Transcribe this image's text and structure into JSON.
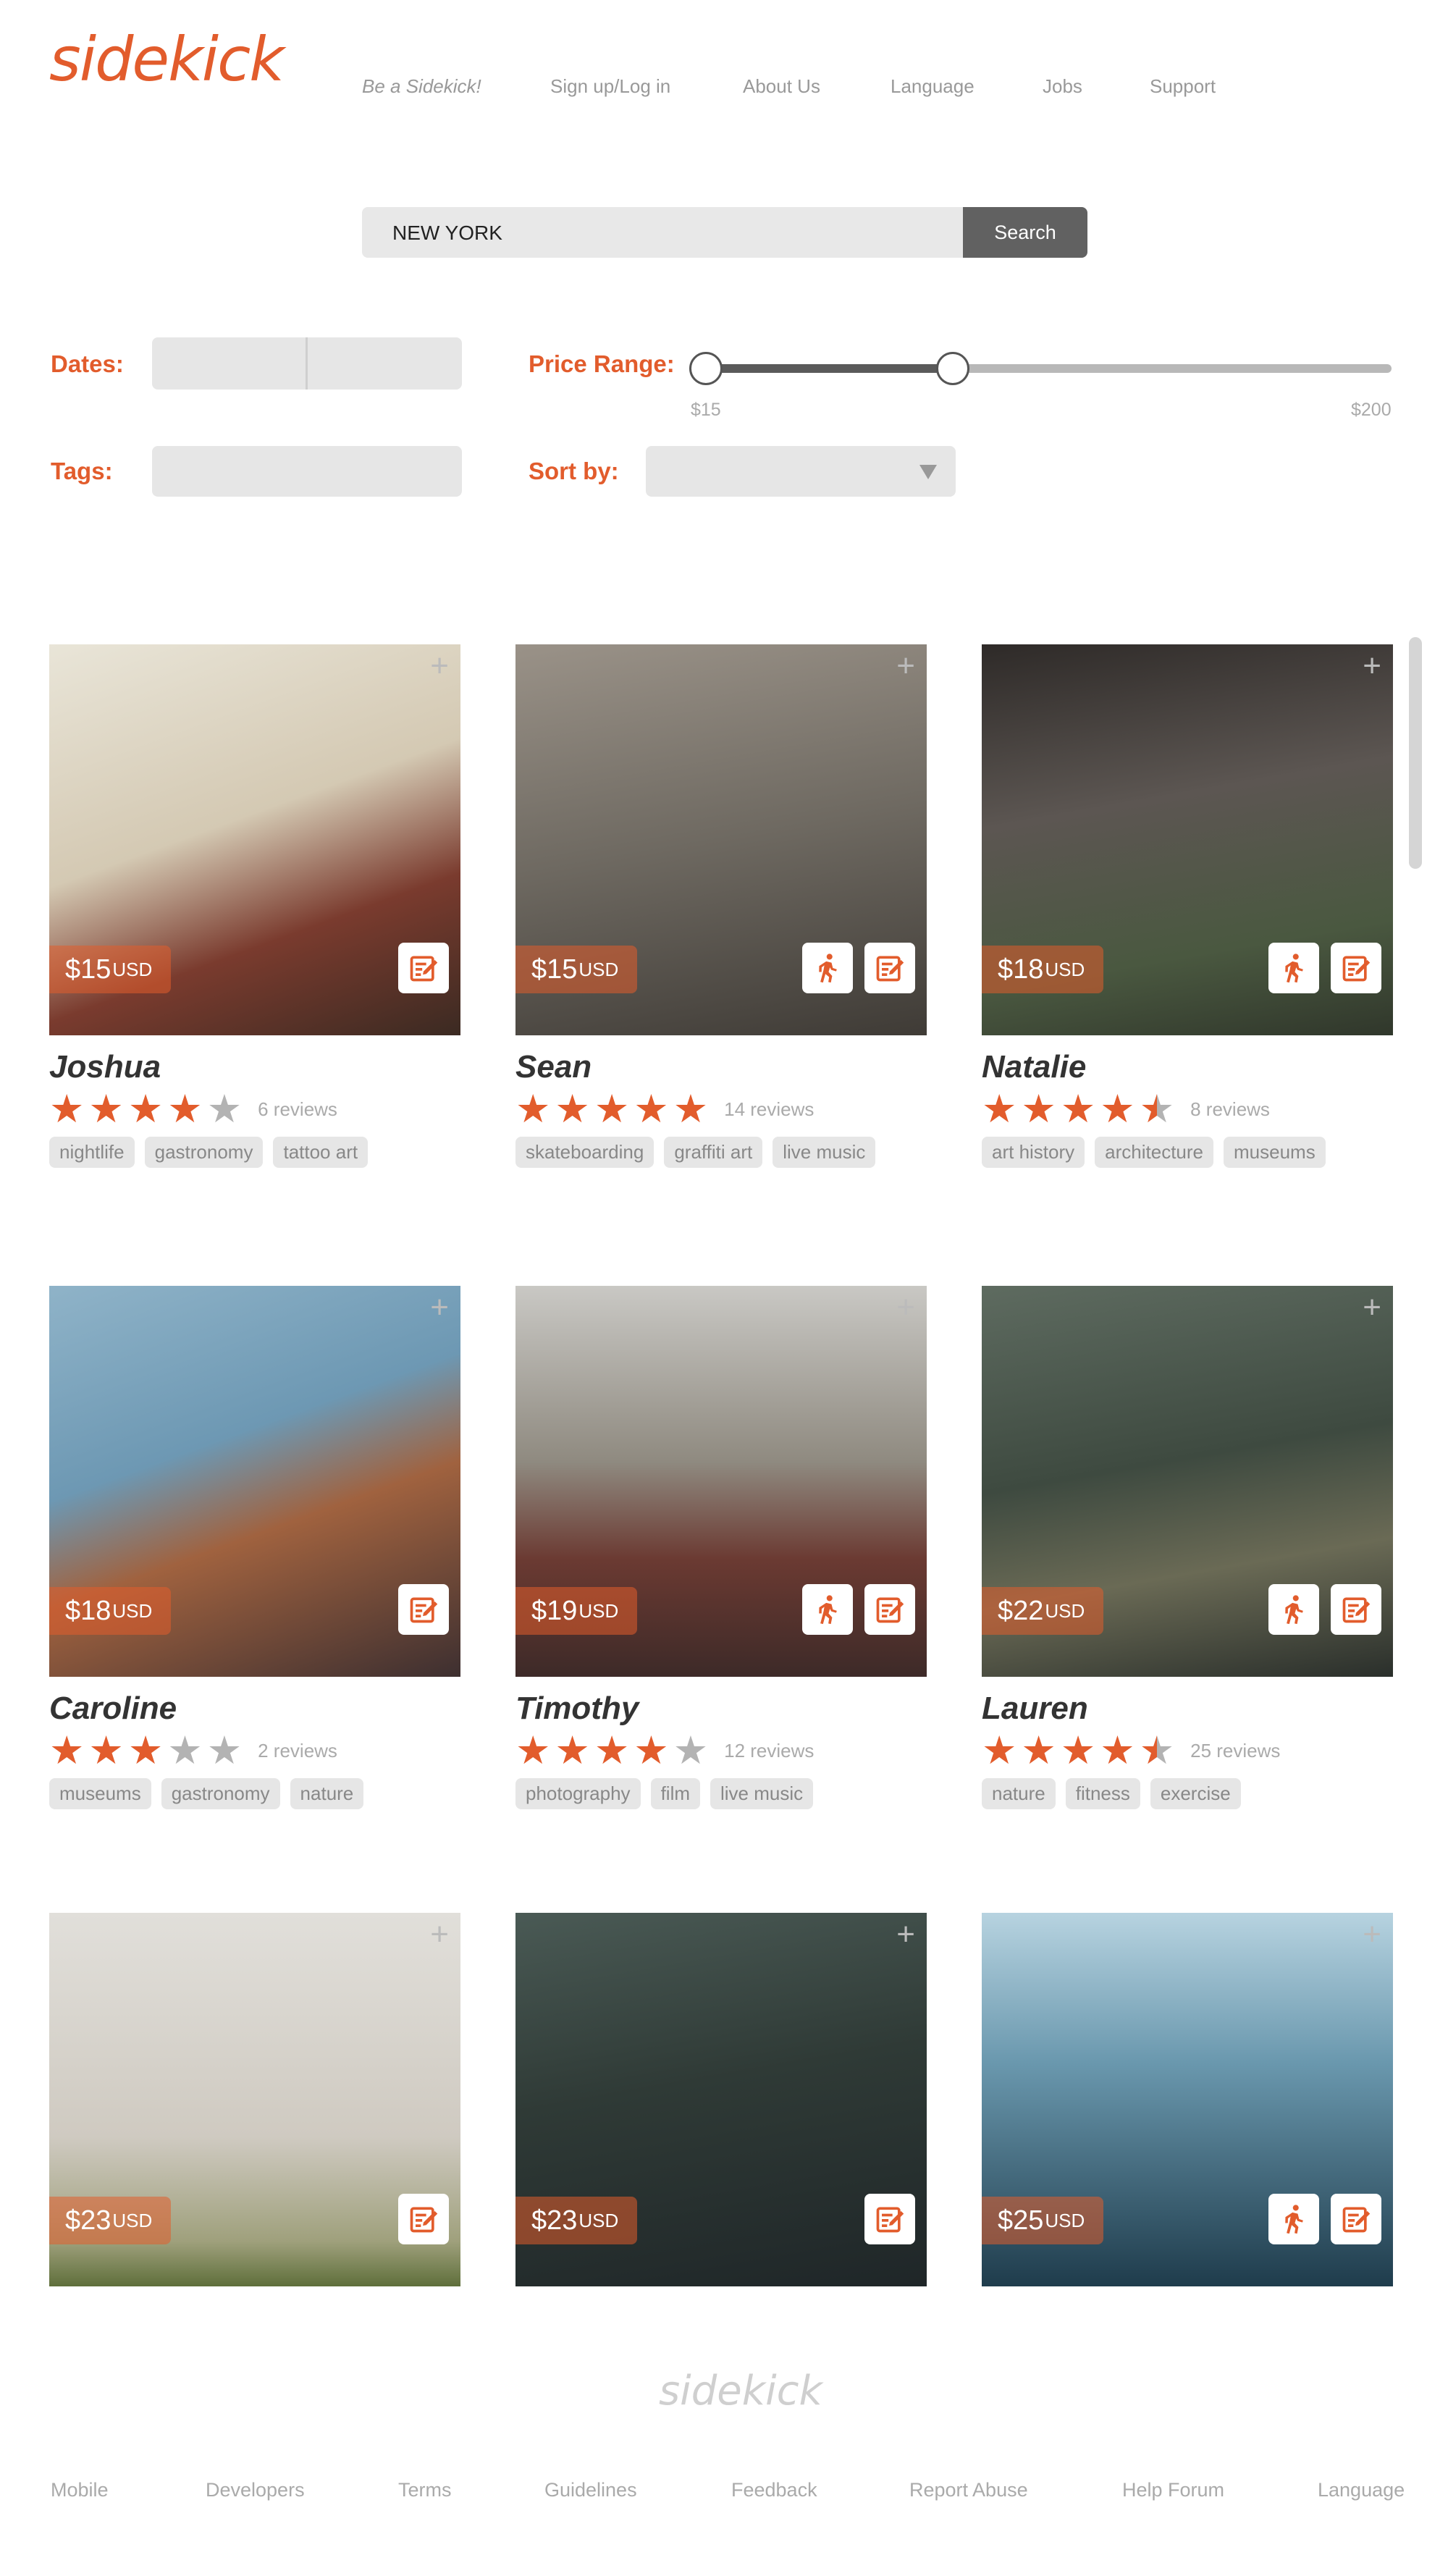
{
  "brand": {
    "logo": "sidekick",
    "accent": "#e25c2c"
  },
  "nav": [
    "Be a Sidekick!",
    "Sign up/Log in",
    "About Us",
    "Language",
    "Jobs",
    "Support"
  ],
  "search": {
    "value": "NEW YORK",
    "button": "Search"
  },
  "filters": {
    "dates_label": "Dates:",
    "price_label": "Price Range:",
    "price_min": "$15",
    "price_max": "$200",
    "price_selected_fraction": 0.36,
    "tags_label": "Tags:",
    "sort_label": "Sort by:"
  },
  "cards": [
    {
      "name": "Joshua",
      "price": "$15",
      "currency": "USD",
      "rating": 4,
      "reviews": "6 reviews",
      "tags": [
        "nightlife",
        "gastronomy",
        "tattoo art"
      ],
      "hike": false
    },
    {
      "name": "Sean",
      "price": "$15",
      "currency": "USD",
      "rating": 5,
      "reviews": "14 reviews",
      "tags": [
        "skateboarding",
        "graffiti art",
        "live music"
      ],
      "hike": true
    },
    {
      "name": "Natalie",
      "price": "$18",
      "currency": "USD",
      "rating": 4.5,
      "reviews": "8 reviews",
      "tags": [
        "art history",
        "architecture",
        "museums"
      ],
      "hike": true
    },
    {
      "name": "Caroline",
      "price": "$18",
      "currency": "USD",
      "rating": 3,
      "reviews": "2 reviews",
      "tags": [
        "museums",
        "gastronomy",
        "nature"
      ],
      "hike": false
    },
    {
      "name": "Timothy",
      "price": "$19",
      "currency": "USD",
      "rating": 4,
      "reviews": "12 reviews",
      "tags": [
        "photography",
        "film",
        "live music"
      ],
      "hike": true
    },
    {
      "name": "Lauren",
      "price": "$22",
      "currency": "USD",
      "rating": 4.5,
      "reviews": "25 reviews",
      "tags": [
        "nature",
        "fitness",
        "exercise"
      ],
      "hike": true
    },
    {
      "name": "",
      "price": "$23",
      "currency": "USD",
      "rating": 0,
      "reviews": "",
      "tags": [],
      "hike": false
    },
    {
      "name": "",
      "price": "$23",
      "currency": "USD",
      "rating": 0,
      "reviews": "",
      "tags": [],
      "hike": false
    },
    {
      "name": "",
      "price": "$25",
      "currency": "USD",
      "rating": 0,
      "reviews": "",
      "tags": [],
      "hike": true
    }
  ],
  "footer": {
    "logo": "sidekick",
    "links": [
      "Mobile",
      "Developers",
      "Terms",
      "Guidelines",
      "Feedback",
      "Report Abuse",
      "Help Forum",
      "Language"
    ]
  }
}
